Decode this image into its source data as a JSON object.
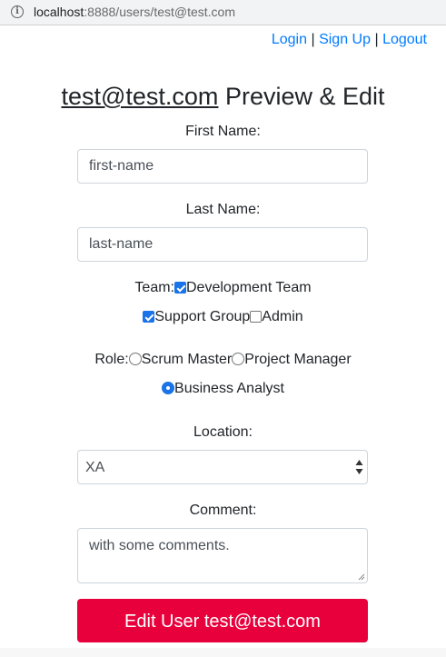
{
  "browser": {
    "url_host": "localhost",
    "url_rest": ":8888/users/test@test.com"
  },
  "nav": {
    "login": "Login",
    "signup": "Sign Up",
    "logout": "Logout",
    "separator": "|"
  },
  "page": {
    "title_email": "test@test.com",
    "title_suffix": " Preview & Edit"
  },
  "form": {
    "first_name_label": "First Name:",
    "first_name_value": "first-name",
    "last_name_label": "Last Name:",
    "last_name_value": "last-name",
    "team_label": "Team:",
    "teams": [
      {
        "label": "Development Team",
        "checked": true
      },
      {
        "label": "Support Group",
        "checked": true
      },
      {
        "label": "Admin",
        "checked": false
      }
    ],
    "role_label": "Role:",
    "roles": [
      {
        "label": "Scrum Master",
        "selected": false
      },
      {
        "label": "Project Manager",
        "selected": false
      },
      {
        "label": "Business Analyst",
        "selected": true
      }
    ],
    "location_label": "Location:",
    "location_value": "XA",
    "comment_label": "Comment:",
    "comment_value": "with some comments.",
    "submit_label": "Edit User test@test.com"
  },
  "colors": {
    "link": "#007bff",
    "checked": "#1a73e8",
    "submit_bg": "#e8003c"
  }
}
